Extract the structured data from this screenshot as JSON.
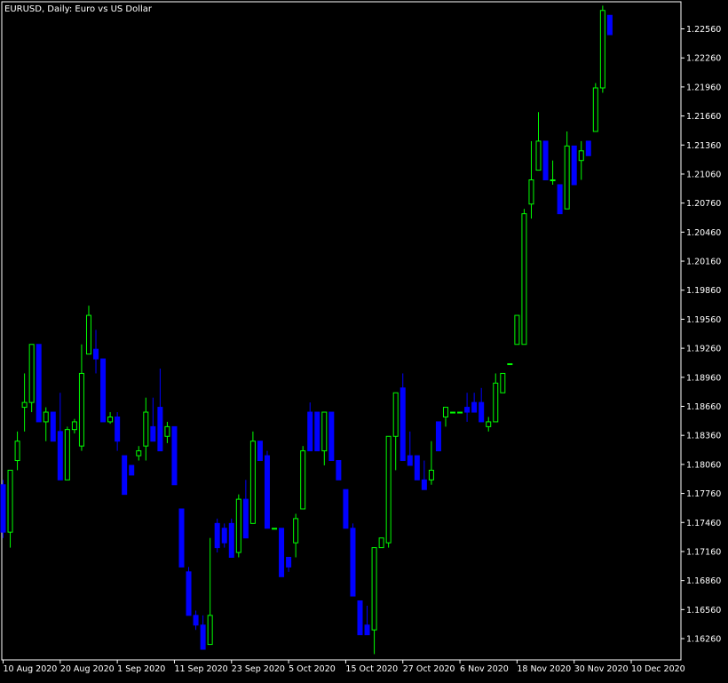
{
  "chart_header": {
    "symbol": "EURUSD",
    "timeframe": "Daily",
    "description": "Euro vs US Dollar",
    "text": "EURUSD, Daily:  Euro vs US Dollar"
  },
  "colors": {
    "background": "#000000",
    "frame": "#ffffff",
    "text": "#ffffff",
    "bull": "#00ff00",
    "bull_body_fill": "#000000",
    "bear": "#0000ff",
    "bear_alt_fill": "#ffffe0"
  },
  "chart_data": {
    "type": "candlestick",
    "title": "EURUSD, Daily:  Euro vs US Dollar",
    "ylim": [
      1.1604,
      1.2284
    ],
    "yticks": [
      "1.22560",
      "1.22260",
      "1.21960",
      "1.21660",
      "1.21360",
      "1.21060",
      "1.20760",
      "1.20460",
      "1.20160",
      "1.19860",
      "1.19560",
      "1.19260",
      "1.18960",
      "1.18660",
      "1.18360",
      "1.18060",
      "1.17760",
      "1.17460",
      "1.17160",
      "1.16860",
      "1.16560",
      "1.16260"
    ],
    "xticks": [
      {
        "label": "10 Aug 2020",
        "index": 0
      },
      {
        "label": "20 Aug 2020",
        "index": 8
      },
      {
        "label": "1 Sep 2020",
        "index": 16
      },
      {
        "label": "11 Sep 2020",
        "index": 24
      },
      {
        "label": "23 Sep 2020",
        "index": 32
      },
      {
        "label": "5 Oct 2020",
        "index": 40
      },
      {
        "label": "15 Oct 2020",
        "index": 48
      },
      {
        "label": "27 Oct 2020",
        "index": 56
      },
      {
        "label": "6 Nov 2020",
        "index": 64
      },
      {
        "label": "18 Nov 2020",
        "index": 72
      },
      {
        "label": "30 Nov 2020",
        "index": 80
      },
      {
        "label": "10 Dec 2020",
        "index": 88
      }
    ],
    "ohlc": [
      [
        1.1785,
        1.179,
        1.173,
        1.1736
      ],
      [
        1.1736,
        1.18,
        1.172,
        1.18
      ],
      [
        1.181,
        1.184,
        1.18,
        1.183
      ],
      [
        1.1865,
        1.19,
        1.184,
        1.187
      ],
      [
        1.187,
        1.1925,
        1.186,
        1.193
      ],
      [
        1.193,
        1.185,
        1.195,
        1.185
      ],
      [
        1.185,
        1.1865,
        1.183,
        1.186
      ],
      [
        1.186,
        1.183,
        1.1865,
        1.183
      ],
      [
        1.184,
        1.188,
        1.179,
        1.179
      ],
      [
        1.179,
        1.1845,
        1.1795,
        1.1842
      ],
      [
        1.1842,
        1.1853,
        1.1838,
        1.185
      ],
      [
        1.1825,
        1.193,
        1.182,
        1.19
      ],
      [
        1.192,
        1.197,
        1.192,
        1.196
      ],
      [
        1.1925,
        1.1945,
        1.19,
        1.1915
      ],
      [
        1.1915,
        1.185,
        1.1915,
        1.185
      ],
      [
        1.185,
        1.186,
        1.1848,
        1.1855
      ],
      [
        1.1855,
        1.186,
        1.182,
        1.183
      ],
      [
        1.1815,
        1.1815,
        1.1775,
        1.1775
      ],
      [
        1.1805,
        1.18,
        1.1795,
        1.1795
      ],
      [
        1.1815,
        1.1825,
        1.181,
        1.182
      ],
      [
        1.1825,
        1.1875,
        1.181,
        1.186
      ],
      [
        1.1845,
        1.1875,
        1.183,
        1.183
      ],
      [
        1.1865,
        1.1905,
        1.182,
        1.182
      ],
      [
        1.1835,
        1.185,
        1.1828,
        1.1845
      ],
      [
        1.1845,
        1.1845,
        1.1785,
        1.1785
      ],
      [
        1.176,
        1.176,
        1.17,
        1.17
      ],
      [
        1.1695,
        1.17,
        1.165,
        1.165
      ],
      [
        1.165,
        1.1655,
        1.1635,
        1.164
      ],
      [
        1.164,
        1.165,
        1.1615,
        1.1615
      ],
      [
        1.162,
        1.173,
        1.1645,
        1.165
      ],
      [
        1.1745,
        1.175,
        1.1715,
        1.172
      ],
      [
        1.174,
        1.1745,
        1.172,
        1.1725
      ],
      [
        1.1745,
        1.175,
        1.171,
        1.171
      ],
      [
        1.1715,
        1.1775,
        1.171,
        1.177
      ],
      [
        1.177,
        1.179,
        1.173,
        1.173
      ],
      [
        1.1745,
        1.184,
        1.1745,
        1.183
      ],
      [
        1.183,
        1.183,
        1.181,
        1.181
      ],
      [
        1.1815,
        1.182,
        1.174,
        1.174
      ],
      [
        1.174,
        1.174,
        1.174,
        1.174
      ],
      [
        1.174,
        1.174,
        1.169,
        1.169
      ],
      [
        1.171,
        1.171,
        1.1695,
        1.17
      ],
      [
        1.1725,
        1.1755,
        1.171,
        1.175
      ],
      [
        1.176,
        1.1825,
        1.176,
        1.182
      ],
      [
        1.186,
        1.187,
        1.182,
        1.182
      ],
      [
        1.186,
        1.186,
        1.182,
        1.182
      ],
      [
        1.182,
        1.186,
        1.1805,
        1.186
      ],
      [
        1.186,
        1.186,
        1.181,
        1.181
      ],
      [
        1.181,
        1.181,
        1.179,
        1.179
      ],
      [
        1.178,
        1.178,
        1.174,
        1.174
      ],
      [
        1.174,
        1.1745,
        1.167,
        1.167
      ],
      [
        1.1665,
        1.165,
        1.163,
        1.163
      ],
      [
        1.164,
        1.166,
        1.163,
        1.163
      ],
      [
        1.1635,
        1.172,
        1.161,
        1.172
      ],
      [
        1.172,
        1.173,
        1.172,
        1.173
      ],
      [
        1.1725,
        1.1835,
        1.172,
        1.1835
      ],
      [
        1.1835,
        1.188,
        1.18,
        1.188
      ],
      [
        1.1885,
        1.19,
        1.181,
        1.181
      ],
      [
        1.1815,
        1.184,
        1.1805,
        1.1805
      ],
      [
        1.1815,
        1.181,
        1.179,
        1.179
      ],
      [
        1.179,
        1.181,
        1.178,
        1.178
      ],
      [
        1.179,
        1.183,
        1.1785,
        1.18
      ],
      [
        1.185,
        1.185,
        1.182,
        1.182
      ],
      [
        1.1855,
        1.1865,
        1.1845,
        1.1865
      ],
      [
        1.186,
        1.186,
        1.186,
        1.186
      ],
      [
        1.186,
        1.186,
        1.186,
        1.186
      ],
      [
        1.1865,
        1.188,
        1.185,
        1.186
      ],
      [
        1.187,
        1.188,
        1.186,
        1.186
      ],
      [
        1.187,
        1.1885,
        1.185,
        1.185
      ],
      [
        1.1845,
        1.1855,
        1.184,
        1.185
      ],
      [
        1.185,
        1.19,
        1.185,
        1.189
      ],
      [
        1.188,
        1.188,
        1.19,
        1.19
      ],
      [
        1.191,
        1.191,
        1.191,
        1.191
      ],
      [
        1.193,
        1.196,
        1.193,
        1.196
      ],
      [
        1.193,
        1.207,
        1.193,
        1.2065
      ],
      [
        1.2075,
        1.214,
        1.206,
        1.21
      ],
      [
        1.211,
        1.217,
        1.211,
        1.214
      ],
      [
        1.214,
        1.214,
        1.21,
        1.21
      ],
      [
        1.21,
        1.212,
        1.2095,
        1.21
      ],
      [
        1.2095,
        1.2095,
        1.2065,
        1.2065
      ],
      [
        1.207,
        1.215,
        1.207,
        1.2135
      ],
      [
        1.2135,
        1.2135,
        1.2095,
        1.2095
      ],
      [
        1.212,
        1.214,
        1.21,
        1.213
      ],
      [
        1.214,
        1.214,
        1.2125,
        1.2125
      ],
      [
        1.215,
        1.22,
        1.215,
        1.2195
      ],
      [
        1.2195,
        1.228,
        1.219,
        1.2275
      ],
      [
        1.227,
        1.227,
        1.225,
        1.225
      ]
    ]
  }
}
